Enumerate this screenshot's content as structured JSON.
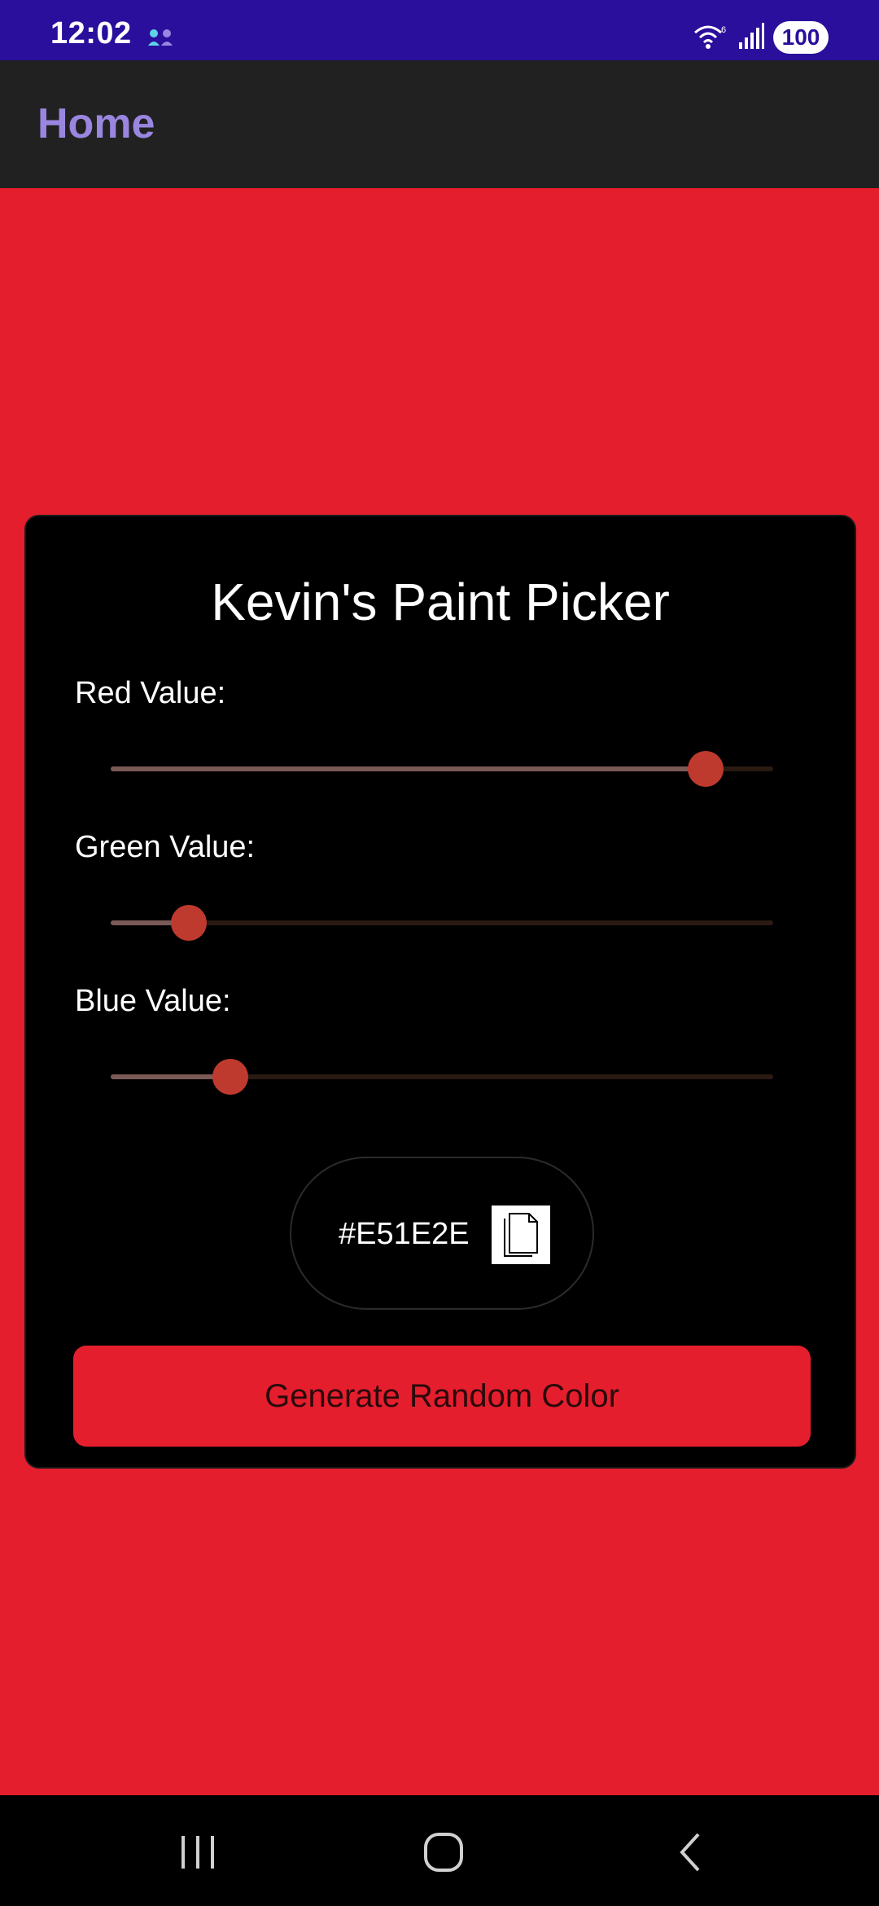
{
  "status_bar": {
    "time": "12:02",
    "battery": "100",
    "icons": [
      "app-notification-icon",
      "wifi-icon",
      "signal-icon"
    ]
  },
  "app_bar": {
    "title": "Home"
  },
  "card": {
    "title": "Kevin's Paint Picker",
    "sliders": [
      {
        "label": "Red Value:",
        "value": 229,
        "max": 255
      },
      {
        "label": "Green Value:",
        "value": 30,
        "max": 255
      },
      {
        "label": "Blue Value:",
        "value": 46,
        "max": 255
      }
    ],
    "hex_value": "#E51E2E",
    "generate_label": "Generate Random Color"
  },
  "colors": {
    "status_bar": "#2A0E9C",
    "app_bar": "#212121",
    "app_title": "#9A86E0",
    "background": "#E51E2E",
    "card": "#000000",
    "slider_thumb": "#BE3A2E"
  },
  "nav_bar": {
    "icons": [
      "recent-apps-icon",
      "home-icon",
      "back-icon"
    ]
  }
}
